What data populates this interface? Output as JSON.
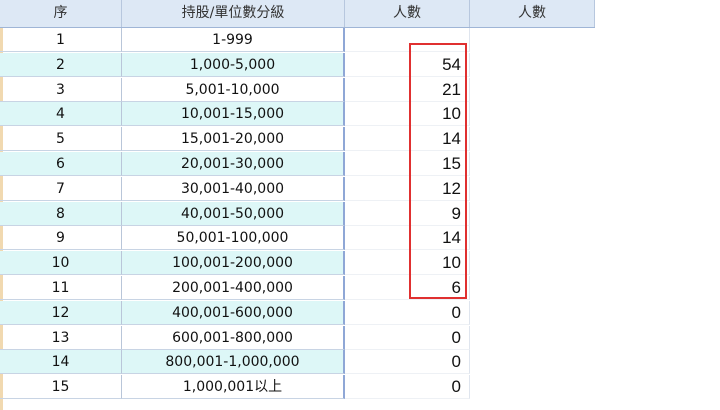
{
  "table": {
    "headers": [
      "序",
      "持股/單位數分級",
      "人數",
      "人數"
    ],
    "rows": [
      {
        "idx": "1",
        "range": "1-999",
        "count": ""
      },
      {
        "idx": "2",
        "range": "1,000-5,000",
        "count": "54"
      },
      {
        "idx": "3",
        "range": "5,001-10,000",
        "count": "21"
      },
      {
        "idx": "4",
        "range": "10,001-15,000",
        "count": "10"
      },
      {
        "idx": "5",
        "range": "15,001-20,000",
        "count": "14"
      },
      {
        "idx": "6",
        "range": "20,001-30,000",
        "count": "15"
      },
      {
        "idx": "7",
        "range": "30,001-40,000",
        "count": "12"
      },
      {
        "idx": "8",
        "range": "40,001-50,000",
        "count": "9"
      },
      {
        "idx": "9",
        "range": "50,001-100,000",
        "count": "14"
      },
      {
        "idx": "10",
        "range": "100,001-200,000",
        "count": "10"
      },
      {
        "idx": "11",
        "range": "200,001-400,000",
        "count": "6"
      },
      {
        "idx": "12",
        "range": "400,001-600,000",
        "count": "0"
      },
      {
        "idx": "13",
        "range": "600,001-800,000",
        "count": "0"
      },
      {
        "idx": "14",
        "range": "800,001-1,000,000",
        "count": "0"
      },
      {
        "idx": "15",
        "range": "1,000,001以上",
        "count": "0"
      }
    ]
  },
  "colors": {
    "header_bg": "#dde8f5",
    "row_alt_bg": "#ddf7f7",
    "highlight_border": "#e03030"
  }
}
